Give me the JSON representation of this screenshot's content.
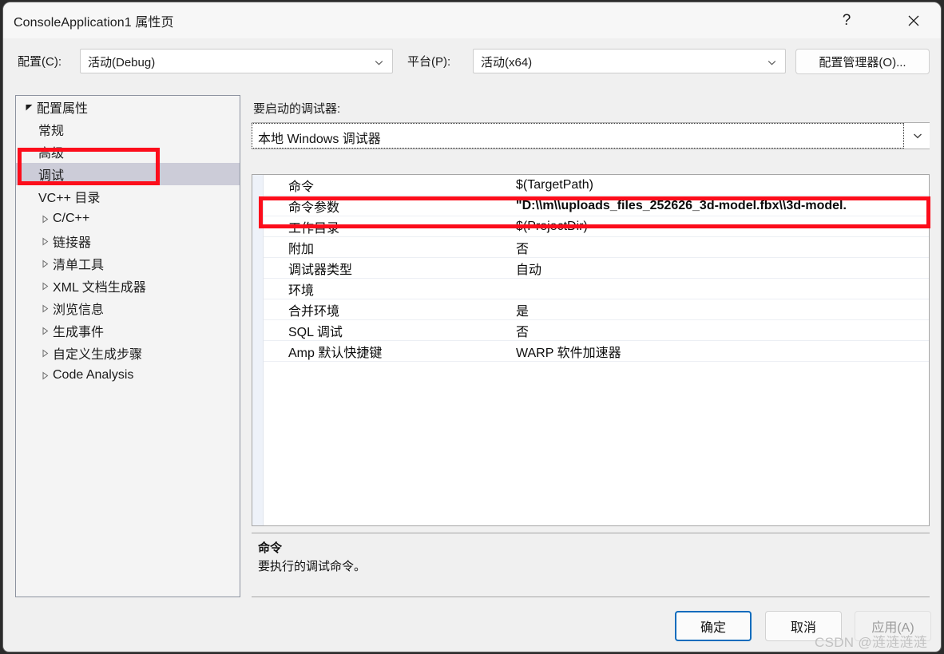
{
  "window": {
    "title": "ConsoleApplication1 属性页",
    "help_icon": "question-mark-icon",
    "close_icon": "close-icon"
  },
  "config_bar": {
    "configuration_label": "配置(C):",
    "configuration_value": "活动(Debug)",
    "platform_label": "平台(P):",
    "platform_value": "活动(x64)",
    "config_manager_button": "配置管理器(O)...",
    "dropdown_icon": "chevron-down-icon"
  },
  "tree": {
    "items": [
      {
        "label": "配置属性",
        "glyph": "triangle-expanded-icon",
        "indent": 0,
        "selected": false
      },
      {
        "label": "常规",
        "glyph": "none",
        "indent": 1,
        "selected": false
      },
      {
        "label": "高级",
        "glyph": "none",
        "indent": 1,
        "selected": false
      },
      {
        "label": "调试",
        "glyph": "none",
        "indent": 1,
        "selected": true
      },
      {
        "label": "VC++ 目录",
        "glyph": "none",
        "indent": 1,
        "selected": false
      },
      {
        "label": "C/C++",
        "glyph": "triangle-collapsed-icon",
        "indent": 1,
        "selected": false
      },
      {
        "label": "链接器",
        "glyph": "triangle-collapsed-icon",
        "indent": 1,
        "selected": false
      },
      {
        "label": "清单工具",
        "glyph": "triangle-collapsed-icon",
        "indent": 1,
        "selected": false
      },
      {
        "label": "XML 文档生成器",
        "glyph": "triangle-collapsed-icon",
        "indent": 1,
        "selected": false
      },
      {
        "label": "浏览信息",
        "glyph": "triangle-collapsed-icon",
        "indent": 1,
        "selected": false
      },
      {
        "label": "生成事件",
        "glyph": "triangle-collapsed-icon",
        "indent": 1,
        "selected": false
      },
      {
        "label": "自定义生成步骤",
        "glyph": "triangle-collapsed-icon",
        "indent": 1,
        "selected": false
      },
      {
        "label": "Code Analysis",
        "glyph": "triangle-collapsed-icon",
        "indent": 1,
        "selected": false
      }
    ]
  },
  "debugger_section": {
    "label": "要启动的调试器:",
    "selected_value": "本地 Windows 调试器",
    "dropdown_icon": "chevron-down-icon"
  },
  "property_grid": {
    "rows": [
      {
        "name": "命令",
        "value": "$(TargetPath)",
        "bold": false
      },
      {
        "name": "命令参数",
        "value": "\"D:\\\\m\\\\uploads_files_252626_3d-model.fbx\\\\3d-model.",
        "bold": true
      },
      {
        "name": "工作目录",
        "value": "$(ProjectDir)",
        "bold": false
      },
      {
        "name": "附加",
        "value": "否",
        "bold": false
      },
      {
        "name": "调试器类型",
        "value": "自动",
        "bold": false
      },
      {
        "name": "环境",
        "value": "",
        "bold": false
      },
      {
        "name": "合并环境",
        "value": "是",
        "bold": false
      },
      {
        "name": "SQL 调试",
        "value": "否",
        "bold": false
      },
      {
        "name": "Amp 默认快捷键",
        "value": "WARP 软件加速器",
        "bold": false
      }
    ]
  },
  "description": {
    "title": "命令",
    "body": "要执行的调试命令。"
  },
  "footer": {
    "ok_label": "确定",
    "cancel_label": "取消",
    "apply_label": "应用(A)"
  },
  "watermark": {
    "text": "CSDN @涟涟涟涟"
  },
  "annotations": {
    "accent_color": "#fc0d1b",
    "tree_highlight_target": "调试",
    "value_highlight_target": "命令参数"
  }
}
